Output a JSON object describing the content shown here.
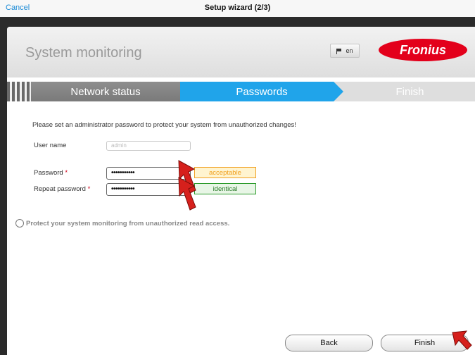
{
  "topbar": {
    "cancel": "Cancel",
    "title": "Setup wizard (2/3)"
  },
  "header": {
    "title": "System monitoring",
    "lang": "en",
    "logo": "Fronius"
  },
  "steps": [
    "Network status",
    "Passwords",
    "Finish"
  ],
  "form": {
    "instruction": "Please set an administrator password to protect your system from unauthorized changes!",
    "username_label": "User name",
    "username_placeholder": "admin",
    "password_label": "Password",
    "password_value": "•••••••••••",
    "repeat_label": "Repeat password",
    "repeat_value": "•••••••••••",
    "required_marker": "*",
    "strength": "acceptable",
    "match": "identical"
  },
  "checkbox_label": "Protect your system monitoring from unauthorized read access.",
  "buttons": {
    "back": "Back",
    "finish": "Finish"
  },
  "colors": {
    "accent": "#20a4ea",
    "brand": "#e3001b",
    "warn": "#f0a020",
    "ok": "#2a9a2a"
  }
}
